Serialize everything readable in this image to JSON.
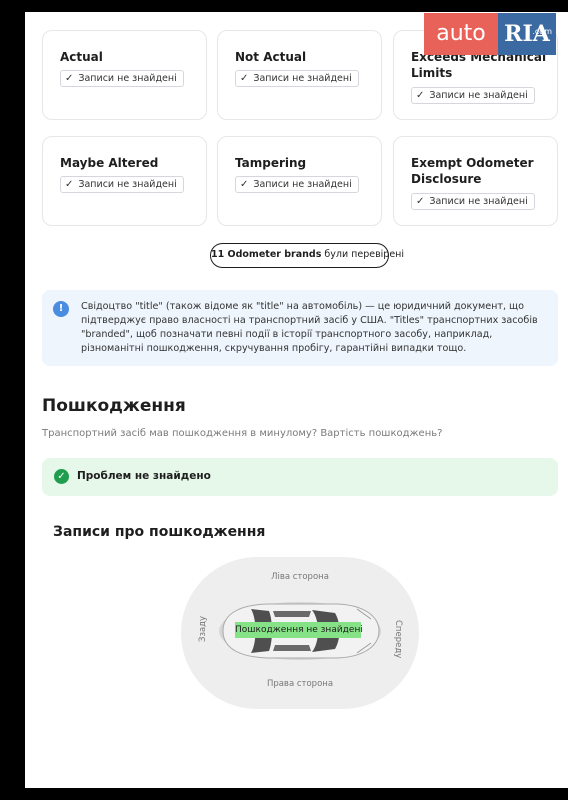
{
  "logo": {
    "auto": "auto",
    "ria": "RIA",
    "domain": ".com"
  },
  "odometer_cards": [
    {
      "title": "Actual",
      "status": "Записи не знайдені"
    },
    {
      "title": "Not Actual",
      "status": "Записи не знайдені"
    },
    {
      "title": "Exceeds Mechanical Limits",
      "status": "Записи не знайдені"
    },
    {
      "title": "Maybe Altered",
      "status": "Записи не знайдені"
    },
    {
      "title": "Tampering",
      "status": "Записи не знайдені"
    },
    {
      "title": "Exempt Odometer Disclosure",
      "status": "Записи не знайдені"
    }
  ],
  "brands_checked": {
    "count_label": "11 Odometer brands",
    "suffix": " були перевірені"
  },
  "info_note": "Свідоцтво \"title\" (також відоме як \"title\" на автомобіль) — це юридичний документ, що підтверджує право власності на транспортний засіб у США. \"Titles\" транспортних засобів \"branded\", щоб позначати певні події в історії транспортного засобу, наприклад, різноманітні пошкодження, скручування пробігу, гарантійні випадки тощо.",
  "damage": {
    "title": "Пошкодження",
    "subtitle": "Транспортний засіб мав пошкодження в минулому? Вартість пошкоджень?",
    "status": "Проблем не знайдено",
    "records_title": "Записи про пошкодження",
    "diagram": {
      "left_side": "Ліва сторона",
      "right_side": "Права сторона",
      "rear": "Ззаду",
      "front": "Спереду",
      "result": "Пошкодження не знайдені"
    }
  },
  "colors": {
    "info_bg": "#eef5fc",
    "info_icon": "#4a8de0",
    "ok_bg": "#e6f8ea",
    "ok_icon": "#1f9e4d",
    "result_label": "#86e286"
  }
}
